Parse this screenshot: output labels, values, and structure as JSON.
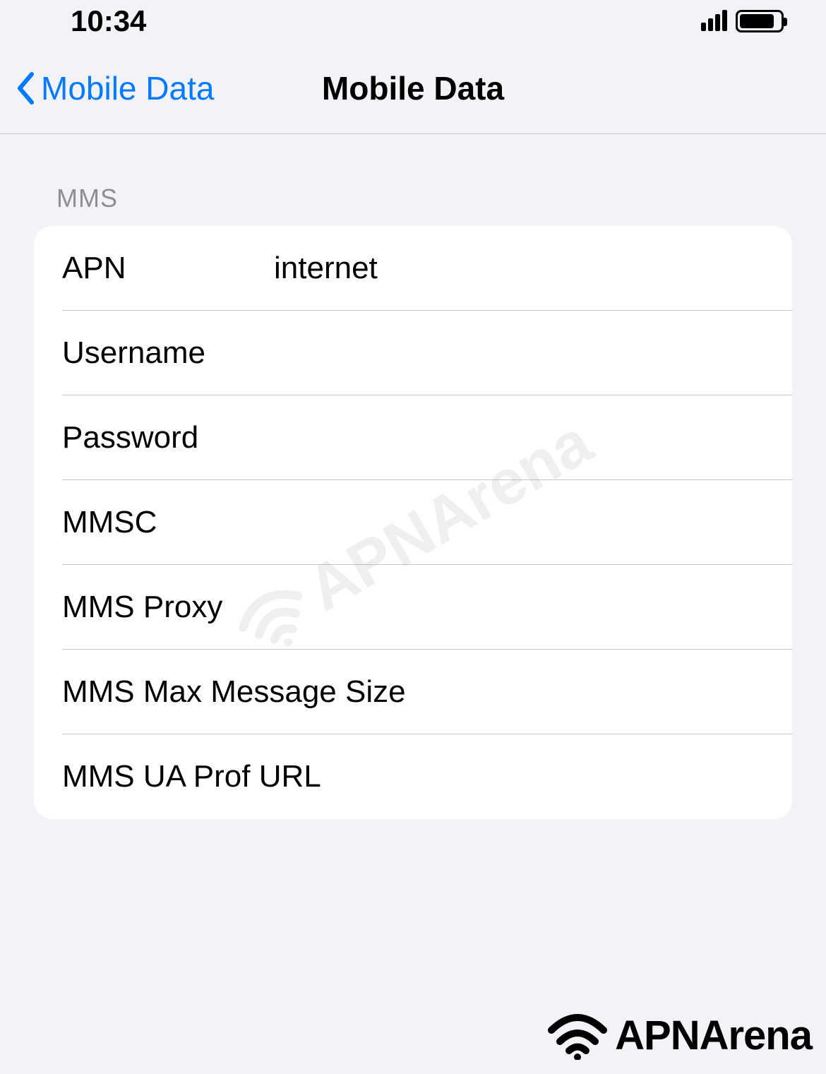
{
  "status_bar": {
    "time": "10:34"
  },
  "nav": {
    "back_label": "Mobile Data",
    "title": "Mobile Data"
  },
  "section": {
    "header": "MMS",
    "rows": {
      "apn": {
        "label": "APN",
        "value": "internet"
      },
      "username": {
        "label": "Username",
        "value": ""
      },
      "password": {
        "label": "Password",
        "value": ""
      },
      "mmsc": {
        "label": "MMSC",
        "value": ""
      },
      "mms_proxy": {
        "label": "MMS Proxy",
        "value": ""
      },
      "mms_max_size": {
        "label": "MMS Max Message Size",
        "value": ""
      },
      "mms_ua_prof": {
        "label": "MMS UA Prof URL",
        "value": ""
      }
    }
  },
  "watermark": {
    "text": "APNArena"
  },
  "footer": {
    "text": "APNArena"
  }
}
